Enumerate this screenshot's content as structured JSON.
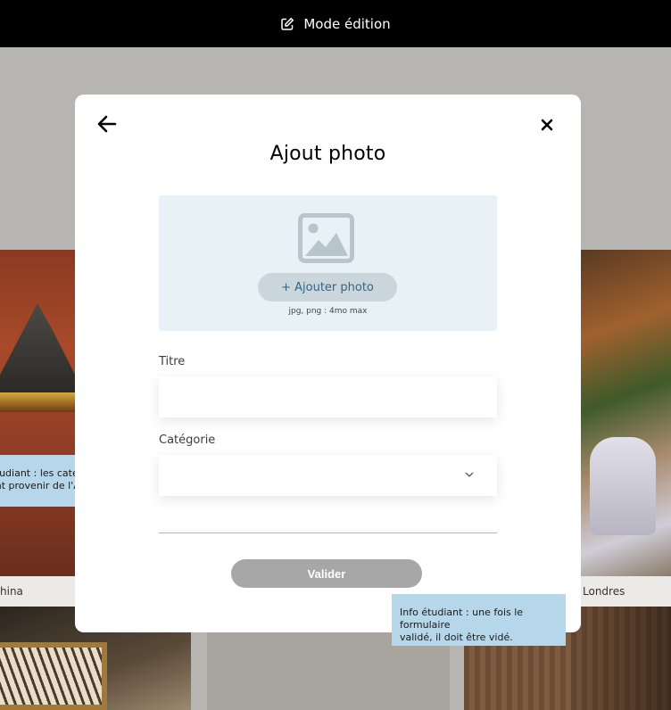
{
  "header": {
    "edit_mode_label": "Mode édition"
  },
  "gallery": {
    "left_caption": "hina",
    "right_caption": "Londres"
  },
  "modal": {
    "title": "Ajout photo",
    "upload": {
      "button_label": "+ Ajouter photo",
      "hint": "jpg, png : 4mo max"
    },
    "fields": {
      "title_label": "Titre",
      "title_value": "",
      "category_label": "Catégorie",
      "category_value": ""
    },
    "submit_label": "Valider"
  },
  "notes": {
    "left_line1": "étudiant : les catégories",
    "left_line2": "ent provenir de l'API.",
    "right_line1": "Info étudiant : une fois le formulaire",
    "right_line2": "validé, il doit être vidé."
  },
  "colors": {
    "topbar": "#000000",
    "overlay": "#b6b5b1",
    "upload_zone": "#e8f1f6",
    "add_photo_button": "#cbd6dc",
    "add_photo_text": "#306685",
    "submit_disabled": "#a7a7a7",
    "note_background": "#b6d6ea"
  }
}
